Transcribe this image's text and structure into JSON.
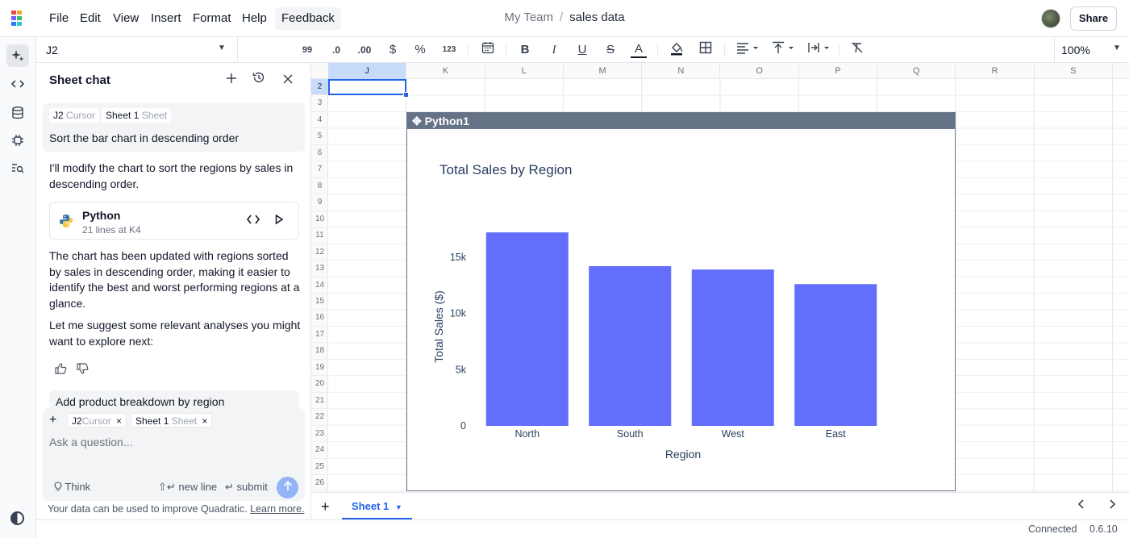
{
  "menu": {
    "items": [
      "File",
      "Edit",
      "View",
      "Insert",
      "Format",
      "Help"
    ],
    "feedback": "Feedback"
  },
  "breadcrumb": {
    "team": "My Team",
    "separator": "/",
    "file": "sales data"
  },
  "share_label": "Share",
  "cell_ref": "J2",
  "toolbar": {
    "quote": "99",
    "dec_decimal": ".0",
    "inc_decimal": ".00",
    "currency": "$",
    "percent": "%",
    "number": "123",
    "bold": "B",
    "italic": "I",
    "underline": "U",
    "strike": "S",
    "text_color": "A",
    "zoom": "100%"
  },
  "chat": {
    "title": "Sheet chat",
    "user_context": [
      {
        "name": "J2",
        "kind": "Cursor"
      },
      {
        "name": "Sheet 1",
        "kind": "Sheet"
      }
    ],
    "user_message": "Sort the bar chart in descending order",
    "reply_1": "I'll modify the chart to sort the regions by sales in descending order.",
    "code_card": {
      "title": "Python",
      "subtitle": "21 lines at K4"
    },
    "reply_2": "The chart has been updated with regions sorted by sales in descending order, making it easier to identify the best and worst performing regions at a glance.",
    "reply_3": "Let me suggest some relevant analyses you might want to explore next:",
    "suggestion": "Add product breakdown by region",
    "input": {
      "chips": [
        {
          "name": "J2",
          "kind": "Cursor"
        },
        {
          "name": "Sheet 1",
          "kind": "Sheet"
        }
      ],
      "placeholder": "Ask a question...",
      "think": "Think",
      "new_line": "new line",
      "submit": "submit"
    },
    "disclaimer": "Your data can be used to improve Quadratic.",
    "disclaimer_link": "Learn more."
  },
  "grid": {
    "columns": [
      "J",
      "K",
      "L",
      "M",
      "N",
      "O",
      "P",
      "Q",
      "R",
      "S"
    ],
    "rows": [
      "2",
      "3",
      "4",
      "5",
      "6",
      "7",
      "8",
      "9",
      "10",
      "11",
      "12",
      "13",
      "14",
      "15",
      "16",
      "17",
      "18",
      "19",
      "20",
      "21",
      "22",
      "23",
      "24",
      "25",
      "26"
    ],
    "selected_col": "J",
    "selected_row": "2"
  },
  "python_block": {
    "name": "Python1"
  },
  "chart_data": {
    "type": "bar",
    "title": "Total Sales by Region",
    "xlabel": "Region",
    "ylabel": "Total Sales ($)",
    "categories": [
      "North",
      "South",
      "West",
      "East"
    ],
    "values": [
      17200,
      14200,
      13900,
      12600
    ],
    "ylim": [
      0,
      18500
    ],
    "yticks": [
      0,
      5000,
      10000,
      15000
    ],
    "ytick_labels": [
      "0",
      "5k",
      "10k",
      "15k"
    ],
    "bar_color": "#636efa",
    "grid": false
  },
  "sheet_tabs": {
    "active": "Sheet 1"
  },
  "status": {
    "connection": "Connected",
    "version": "0.6.10"
  },
  "colors": {
    "accent": "#2563eb",
    "selection_header": "#c7dbfb",
    "python_header": "#667386"
  }
}
